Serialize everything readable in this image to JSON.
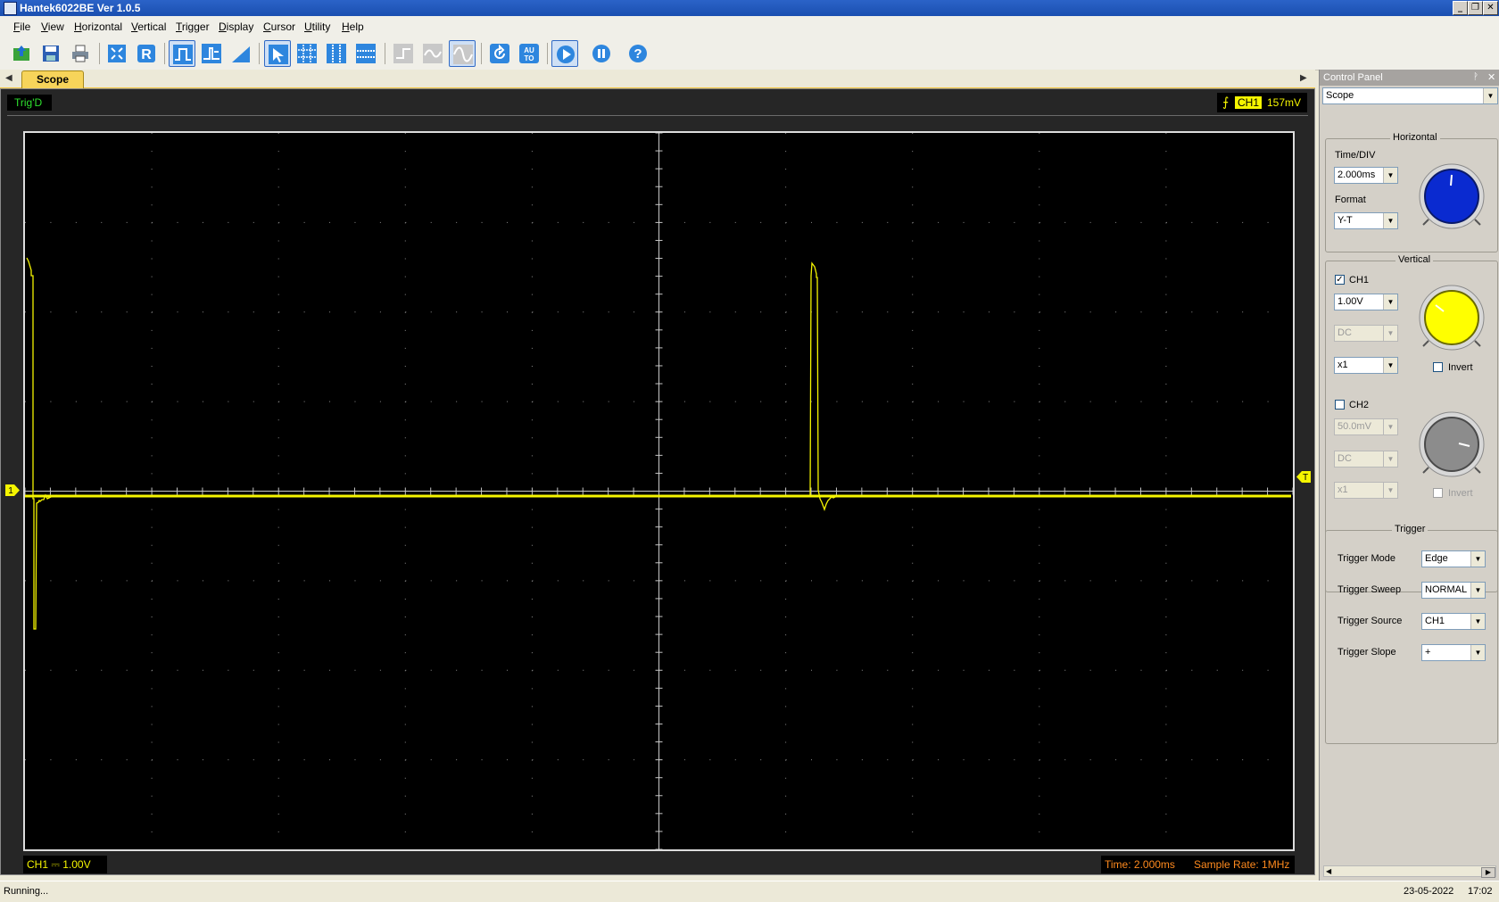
{
  "window": {
    "title": "Hantek6022BE Ver 1.0.5"
  },
  "menu": [
    "File",
    "View",
    "Horizontal",
    "Vertical",
    "Trigger",
    "Display",
    "Cursor",
    "Utility",
    "Help"
  ],
  "tabs": {
    "scope": "Scope"
  },
  "scope": {
    "trig_status": "Trig'D",
    "trigger": {
      "slope": "⨍",
      "channel": "CH1",
      "level": "157mV"
    },
    "ch1_info": "CH1 ⎓   1.00V",
    "time_info": "Time: 2.000ms",
    "sample_rate": "Sample Rate: 1MHz",
    "marker_ch1": "1",
    "marker_trigger": "T"
  },
  "control_panel": {
    "title": "Control Panel",
    "mode": "Scope",
    "horizontal": {
      "title": "Horizontal",
      "time_div_label": "Time/DIV",
      "time_div": "2.000ms",
      "format_label": "Format",
      "format": "Y-T"
    },
    "vertical": {
      "title": "Vertical",
      "ch1": {
        "label": "CH1",
        "checked": true,
        "volts": "1.00V",
        "coupling": "DC",
        "probe": "x1",
        "invert_label": "Invert"
      },
      "ch2": {
        "label": "CH2",
        "checked": false,
        "volts": "50.0mV",
        "coupling": "DC",
        "probe": "x1",
        "invert_label": "Invert"
      }
    },
    "trigger": {
      "title": "Trigger",
      "mode_label": "Trigger Mode",
      "mode": "Edge",
      "sweep_label": "Trigger Sweep",
      "sweep": "NORMAL",
      "source_label": "Trigger Source",
      "source": "CH1",
      "slope_label": "Trigger Slope",
      "slope": "+"
    }
  },
  "status": {
    "text": "Running...",
    "date": "23-05-2022",
    "time": "17:02"
  },
  "colors": {
    "trace": "#f5f500",
    "ch1_knob": "#ffff00",
    "horizontal_knob": "#0a2ad0",
    "ch2_knob": "#8c8c8c"
  }
}
